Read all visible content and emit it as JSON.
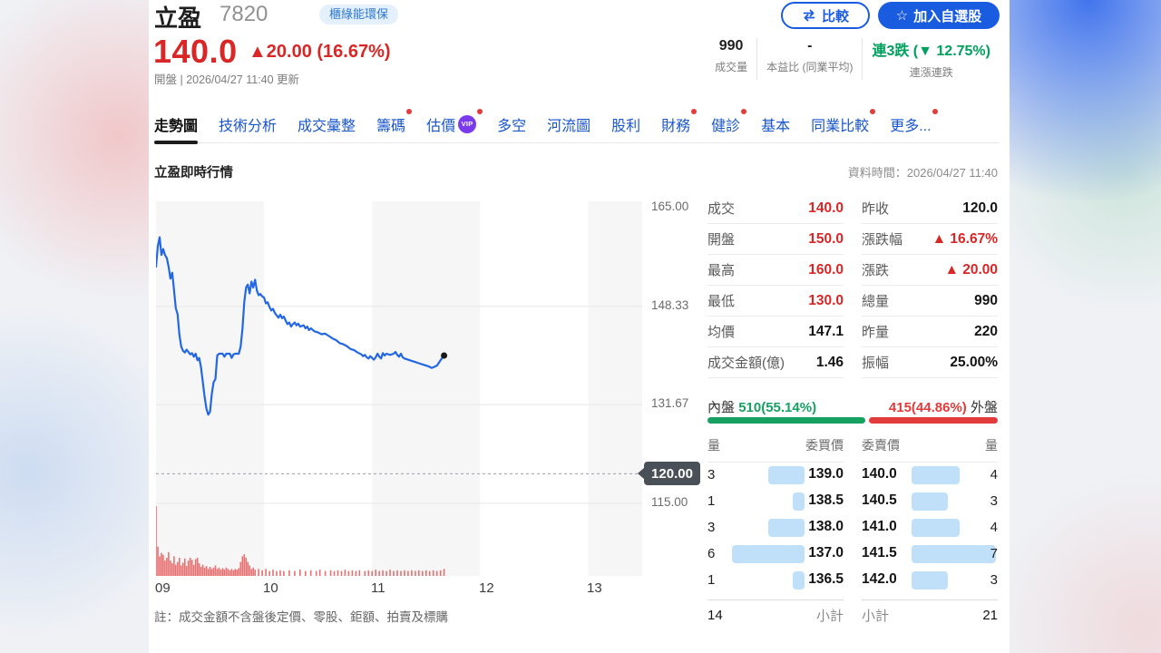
{
  "header": {
    "stock_name": "立盈",
    "stock_code": "7820",
    "tag": "櫃綠能環保",
    "price": "140.0",
    "change": "▲20.00 (16.67%)",
    "update_info": "開盤 | 2026/04/27 11:40 更新",
    "compare_label": "比較",
    "watchlist_label": "加入自選股",
    "quick_stats": [
      {
        "value": "990",
        "label": "成交量",
        "color": "dark"
      },
      {
        "value": "-",
        "label": "本益比 (同業平均)",
        "color": "dark"
      },
      {
        "value": "連3跌 (▼ 12.75%)",
        "label": "連漲連跌",
        "color": "green"
      }
    ]
  },
  "tabs": [
    {
      "label": "走勢圖",
      "active": true,
      "dot": false,
      "vip": false
    },
    {
      "label": "技術分析",
      "active": false,
      "dot": false,
      "vip": false
    },
    {
      "label": "成交彙整",
      "active": false,
      "dot": false,
      "vip": false
    },
    {
      "label": "籌碼",
      "active": false,
      "dot": true,
      "vip": false
    },
    {
      "label": "估價",
      "active": false,
      "dot": true,
      "vip": true
    },
    {
      "label": "多空",
      "active": false,
      "dot": false,
      "vip": false
    },
    {
      "label": "河流圖",
      "active": false,
      "dot": false,
      "vip": false
    },
    {
      "label": "股利",
      "active": false,
      "dot": false,
      "vip": false
    },
    {
      "label": "財務",
      "active": false,
      "dot": true,
      "vip": false
    },
    {
      "label": "健診",
      "active": false,
      "dot": true,
      "vip": false
    },
    {
      "label": "基本",
      "active": false,
      "dot": false,
      "vip": false
    },
    {
      "label": "同業比較",
      "active": false,
      "dot": true,
      "vip": false
    },
    {
      "label": "更多...",
      "active": false,
      "dot": true,
      "vip": false
    }
  ],
  "vip_badge_label": "VIP",
  "section": {
    "title": "立盈即時行情",
    "data_time": "資料時間：2026/04/27 11:40"
  },
  "chart_data": {
    "type": "line",
    "title": "立盈即時行情",
    "x_axis": {
      "labels": [
        "09",
        "10",
        "11",
        "12",
        "13"
      ],
      "range_minutes": [
        0,
        270
      ]
    },
    "y_axis": {
      "ticks": [
        "165.00",
        "148.33",
        "131.67",
        "115.00"
      ],
      "min": 115,
      "max": 165
    },
    "prev_close": 120.0,
    "prev_close_label": "120.00",
    "grid": true,
    "line_color": "#2467e3",
    "volume_color": "#e87070",
    "price_points": [
      [
        0,
        155
      ],
      [
        1,
        158.5
      ],
      [
        2,
        160
      ],
      [
        3,
        157
      ],
      [
        4,
        158
      ],
      [
        5,
        157
      ],
      [
        6,
        156.5
      ],
      [
        7,
        155
      ],
      [
        8,
        153
      ],
      [
        9,
        154
      ],
      [
        10,
        151
      ],
      [
        11,
        148
      ],
      [
        12,
        147
      ],
      [
        13,
        143.5
      ],
      [
        14,
        141.5
      ],
      [
        15,
        140.8
      ],
      [
        16,
        140.5
      ],
      [
        17,
        141
      ],
      [
        18,
        140.6
      ],
      [
        19,
        140.2
      ],
      [
        20,
        140.4
      ],
      [
        21,
        139.8
      ],
      [
        22,
        140.3
      ],
      [
        23,
        139.2
      ],
      [
        24,
        139.6
      ],
      [
        25,
        138
      ],
      [
        26,
        135.5
      ],
      [
        27,
        133
      ],
      [
        28,
        131
      ],
      [
        29,
        130
      ],
      [
        30,
        130.5
      ],
      [
        31,
        133.5
      ],
      [
        32,
        135.5
      ],
      [
        33,
        136
      ],
      [
        34,
        140
      ],
      [
        35,
        140.3
      ],
      [
        37,
        140.3
      ],
      [
        38,
        139.8
      ],
      [
        39,
        140.3
      ],
      [
        41,
        140.3
      ],
      [
        42,
        139.6
      ],
      [
        43,
        140.2
      ],
      [
        44,
        140.3
      ],
      [
        46,
        140.3
      ],
      [
        47,
        141.5
      ],
      [
        48,
        144.5
      ],
      [
        49,
        149
      ],
      [
        50,
        151.5
      ],
      [
        51,
        152
      ],
      [
        52,
        150.5
      ],
      [
        53,
        152.5
      ],
      [
        54,
        151.5
      ],
      [
        55,
        152.8
      ],
      [
        56,
        151
      ],
      [
        57,
        150.2
      ],
      [
        58,
        150.4
      ],
      [
        59,
        150
      ],
      [
        60,
        149.8
      ],
      [
        61,
        148.8
      ],
      [
        62,
        149
      ],
      [
        63,
        148.2
      ],
      [
        64,
        147.6
      ],
      [
        65,
        147.9
      ],
      [
        66,
        147.2
      ],
      [
        67,
        146.8
      ],
      [
        68,
        146.4
      ],
      [
        69,
        146.9
      ],
      [
        70,
        146.3
      ],
      [
        71,
        146.6
      ],
      [
        72,
        145.9
      ],
      [
        73,
        145.3
      ],
      [
        74,
        145.6
      ],
      [
        75,
        144.9
      ],
      [
        76,
        145.3
      ],
      [
        77,
        145.6
      ],
      [
        78,
        145.1
      ],
      [
        79,
        145.4
      ],
      [
        80,
        144.9
      ],
      [
        82,
        145.1
      ],
      [
        83,
        144.6
      ],
      [
        84,
        144.9
      ],
      [
        85,
        144.3
      ],
      [
        86,
        144.6
      ],
      [
        88,
        144.1
      ],
      [
        90,
        143.9
      ],
      [
        92,
        143.6
      ],
      [
        94,
        143.7
      ],
      [
        96,
        143.3
      ],
      [
        98,
        142.9
      ],
      [
        100,
        142.6
      ],
      [
        102,
        142.1
      ],
      [
        104,
        141.9
      ],
      [
        106,
        141.6
      ],
      [
        108,
        141.1
      ],
      [
        110,
        140.9
      ],
      [
        112,
        140.5
      ],
      [
        114,
        140.2
      ],
      [
        115,
        139.9
      ],
      [
        116,
        140.1
      ],
      [
        117,
        139.7
      ],
      [
        118,
        139.5
      ],
      [
        119,
        139.9
      ],
      [
        120,
        139.6
      ],
      [
        121,
        139.3
      ],
      [
        122,
        139.7
      ],
      [
        123,
        140.3
      ],
      [
        124,
        139.8
      ],
      [
        125,
        139.5
      ],
      [
        126,
        140.4
      ],
      [
        127,
        140
      ],
      [
        128,
        140.3
      ],
      [
        130,
        140.1
      ],
      [
        132,
        140.3
      ],
      [
        133,
        140.6
      ],
      [
        134,
        140.1
      ],
      [
        135,
        139.8
      ],
      [
        136,
        140.3
      ],
      [
        137,
        139.7
      ],
      [
        138,
        139.5
      ],
      [
        140,
        139.3
      ],
      [
        142,
        139.1
      ],
      [
        144,
        138.9
      ],
      [
        146,
        138.7
      ],
      [
        148,
        138.5
      ],
      [
        150,
        138.3
      ],
      [
        152,
        138.1
      ],
      [
        153,
        137.9
      ],
      [
        154,
        138
      ],
      [
        156,
        138.3
      ],
      [
        158,
        139.2
      ],
      [
        160,
        140
      ]
    ],
    "volume_points": [
      [
        0,
        1.0
      ],
      [
        1,
        0.42
      ],
      [
        2,
        0.28
      ],
      [
        3,
        0.33
      ],
      [
        4,
        0.3
      ],
      [
        5,
        0.22
      ],
      [
        6,
        0.26
      ],
      [
        7,
        0.34
      ],
      [
        8,
        0.22
      ],
      [
        9,
        0.18
      ],
      [
        10,
        0.28
      ],
      [
        11,
        0.16
      ],
      [
        12,
        0.2
      ],
      [
        13,
        0.26
      ],
      [
        14,
        0.15
      ],
      [
        15,
        0.19
      ],
      [
        16,
        0.25
      ],
      [
        17,
        0.14
      ],
      [
        18,
        0.22
      ],
      [
        19,
        0.26
      ],
      [
        20,
        0.23
      ],
      [
        21,
        0.16
      ],
      [
        22,
        0.24
      ],
      [
        23,
        0.26
      ],
      [
        24,
        0.18
      ],
      [
        25,
        0.13
      ],
      [
        26,
        0.16
      ],
      [
        27,
        0.12
      ],
      [
        28,
        0.14
      ],
      [
        29,
        0.1
      ],
      [
        30,
        0.13
      ],
      [
        31,
        0.1
      ],
      [
        32,
        0.12
      ],
      [
        33,
        0.15
      ],
      [
        34,
        0.1
      ],
      [
        35,
        0.12
      ],
      [
        36,
        0.09
      ],
      [
        37,
        0.11
      ],
      [
        38,
        0.09
      ],
      [
        39,
        0.12
      ],
      [
        40,
        0.1
      ],
      [
        41,
        0.08
      ],
      [
        42,
        0.1
      ],
      [
        43,
        0.08
      ],
      [
        44,
        0.1
      ],
      [
        45,
        0.09
      ],
      [
        46,
        0.11
      ],
      [
        47,
        0.2
      ],
      [
        48,
        0.28
      ],
      [
        49,
        0.31
      ],
      [
        50,
        0.26
      ],
      [
        51,
        0.2
      ],
      [
        52,
        0.15
      ],
      [
        53,
        0.1
      ],
      [
        54,
        0.12
      ],
      [
        55,
        0.09
      ],
      [
        57,
        0.1
      ],
      [
        59,
        0.08
      ],
      [
        61,
        0.1
      ],
      [
        63,
        0.07
      ],
      [
        65,
        0.09
      ],
      [
        67,
        0.07
      ],
      [
        69,
        0.08
      ],
      [
        71,
        0.07
      ],
      [
        74,
        0.08
      ],
      [
        77,
        0.07
      ],
      [
        80,
        0.09
      ],
      [
        83,
        0.07
      ],
      [
        86,
        0.08
      ],
      [
        89,
        0.07
      ],
      [
        91,
        0.09
      ],
      [
        94,
        0.07
      ],
      [
        97,
        0.08
      ],
      [
        99,
        0.07
      ],
      [
        101,
        0.08
      ],
      [
        103,
        0.07
      ],
      [
        105,
        0.09
      ],
      [
        107,
        0.07
      ],
      [
        109,
        0.08
      ],
      [
        111,
        0.07
      ],
      [
        113,
        0.08
      ],
      [
        116,
        0.07
      ],
      [
        118,
        0.08
      ],
      [
        120,
        0.07
      ],
      [
        122,
        0.09
      ],
      [
        124,
        0.07
      ],
      [
        126,
        0.08
      ],
      [
        128,
        0.07
      ],
      [
        130,
        0.09
      ],
      [
        132,
        0.07
      ],
      [
        134,
        0.08
      ],
      [
        136,
        0.07
      ],
      [
        138,
        0.08
      ],
      [
        140,
        0.07
      ],
      [
        142,
        0.08
      ],
      [
        144,
        0.07
      ],
      [
        146,
        0.08
      ],
      [
        148,
        0.07
      ],
      [
        150,
        0.08
      ],
      [
        152,
        0.07
      ],
      [
        154,
        0.08
      ],
      [
        156,
        0.07
      ],
      [
        158,
        0.08
      ],
      [
        160,
        0.1
      ]
    ]
  },
  "stats": {
    "left": [
      {
        "label": "成交",
        "value": "140.0",
        "class": "red"
      },
      {
        "label": "開盤",
        "value": "150.0",
        "class": "red"
      },
      {
        "label": "最高",
        "value": "160.0",
        "class": "red"
      },
      {
        "label": "最低",
        "value": "130.0",
        "class": "red"
      },
      {
        "label": "均價",
        "value": "147.1",
        "class": ""
      },
      {
        "label": "成交金額(億)",
        "value": "1.46",
        "class": ""
      }
    ],
    "right": [
      {
        "label": "昨收",
        "value": "120.0",
        "class": ""
      },
      {
        "label": "漲跌幅",
        "value": "▲ 16.67%",
        "class": "red"
      },
      {
        "label": "漲跌",
        "value": "▲ 20.00",
        "class": "red"
      },
      {
        "label": "總量",
        "value": "990",
        "class": ""
      },
      {
        "label": "昨量",
        "value": "220",
        "class": ""
      },
      {
        "label": "振幅",
        "value": "25.00%",
        "class": ""
      }
    ]
  },
  "inner_outer": {
    "inner_label": "內盤",
    "inner_value": "510(55.14%)",
    "inner_pct": 55.14,
    "outer_value": "415(44.86%)",
    "outer_label": "外盤",
    "outer_pct": 44.86
  },
  "order_book": {
    "headers": [
      "量",
      "委買價",
      "委賣價",
      "量"
    ],
    "bids": [
      {
        "qty": 3,
        "price": "139.0"
      },
      {
        "qty": 1,
        "price": "138.5"
      },
      {
        "qty": 3,
        "price": "138.0"
      },
      {
        "qty": 6,
        "price": "137.0"
      },
      {
        "qty": 1,
        "price": "136.5"
      }
    ],
    "asks": [
      {
        "price": "140.0",
        "qty": 4
      },
      {
        "price": "140.5",
        "qty": 3
      },
      {
        "price": "141.0",
        "qty": 4
      },
      {
        "price": "141.5",
        "qty": 7
      },
      {
        "price": "142.0",
        "qty": 3
      }
    ],
    "max_qty": 7,
    "bid_total": "14",
    "subtotal_label": "小計",
    "ask_total": "21"
  },
  "note": "註：成交金額不含盤後定價、零股、鉅額、拍賣及標購",
  "colors": {
    "accent_blue": "#1a5ce0",
    "up_red": "#d92626",
    "down_green": "#16a163",
    "inner_green": "#16a163",
    "outer_red": "#e23b3b",
    "depth_bar_blue": "#bfe0f8",
    "line_blue": "#2467e3",
    "volume_red": "#e87070",
    "prev_close_tag": "#4a5058",
    "vip_purple": "#7c3aed"
  }
}
